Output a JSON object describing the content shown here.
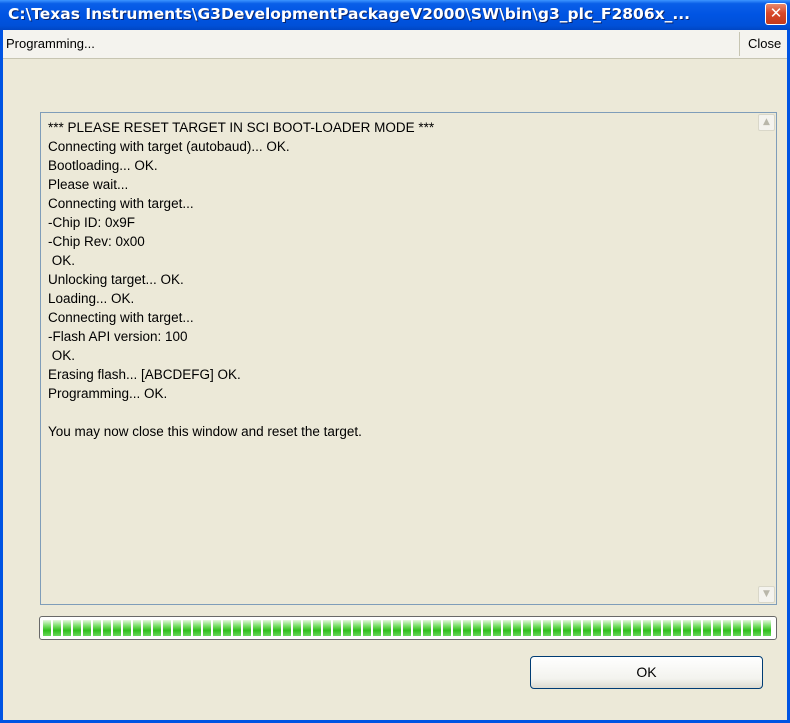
{
  "window": {
    "title": "C:\\Texas Instruments\\G3DevelopmentPackageV2000\\SW\\bin\\g3_plc_F2806x_...",
    "close_glyph": "✕"
  },
  "statusbar": {
    "status": "Programming...",
    "close_label": "Close"
  },
  "log": {
    "text": "*** PLEASE RESET TARGET IN SCI BOOT-LOADER MODE ***\nConnecting with target (autobaud)... OK.\nBootloading... OK.\nPlease wait...\nConnecting with target...\n-Chip ID: 0x9F\n-Chip Rev: 0x00\n OK.\nUnlocking target... OK.\nLoading... OK.\nConnecting with target...\n-Flash API version: 100\n OK.\nErasing flash... [ABCDEFG] OK.\nProgramming... OK.\n\nYou may now close this window and reset the target.",
    "scroll_up_glyph": "▲",
    "scroll_down_glyph": "▼"
  },
  "progress": {
    "value_percent": 100
  },
  "buttons": {
    "ok": "OK"
  },
  "colors": {
    "titlebar": "#0054e3",
    "window_bg": "#ece9d8",
    "progress_green": "#2fbe1b",
    "close_red": "#d8482a"
  }
}
